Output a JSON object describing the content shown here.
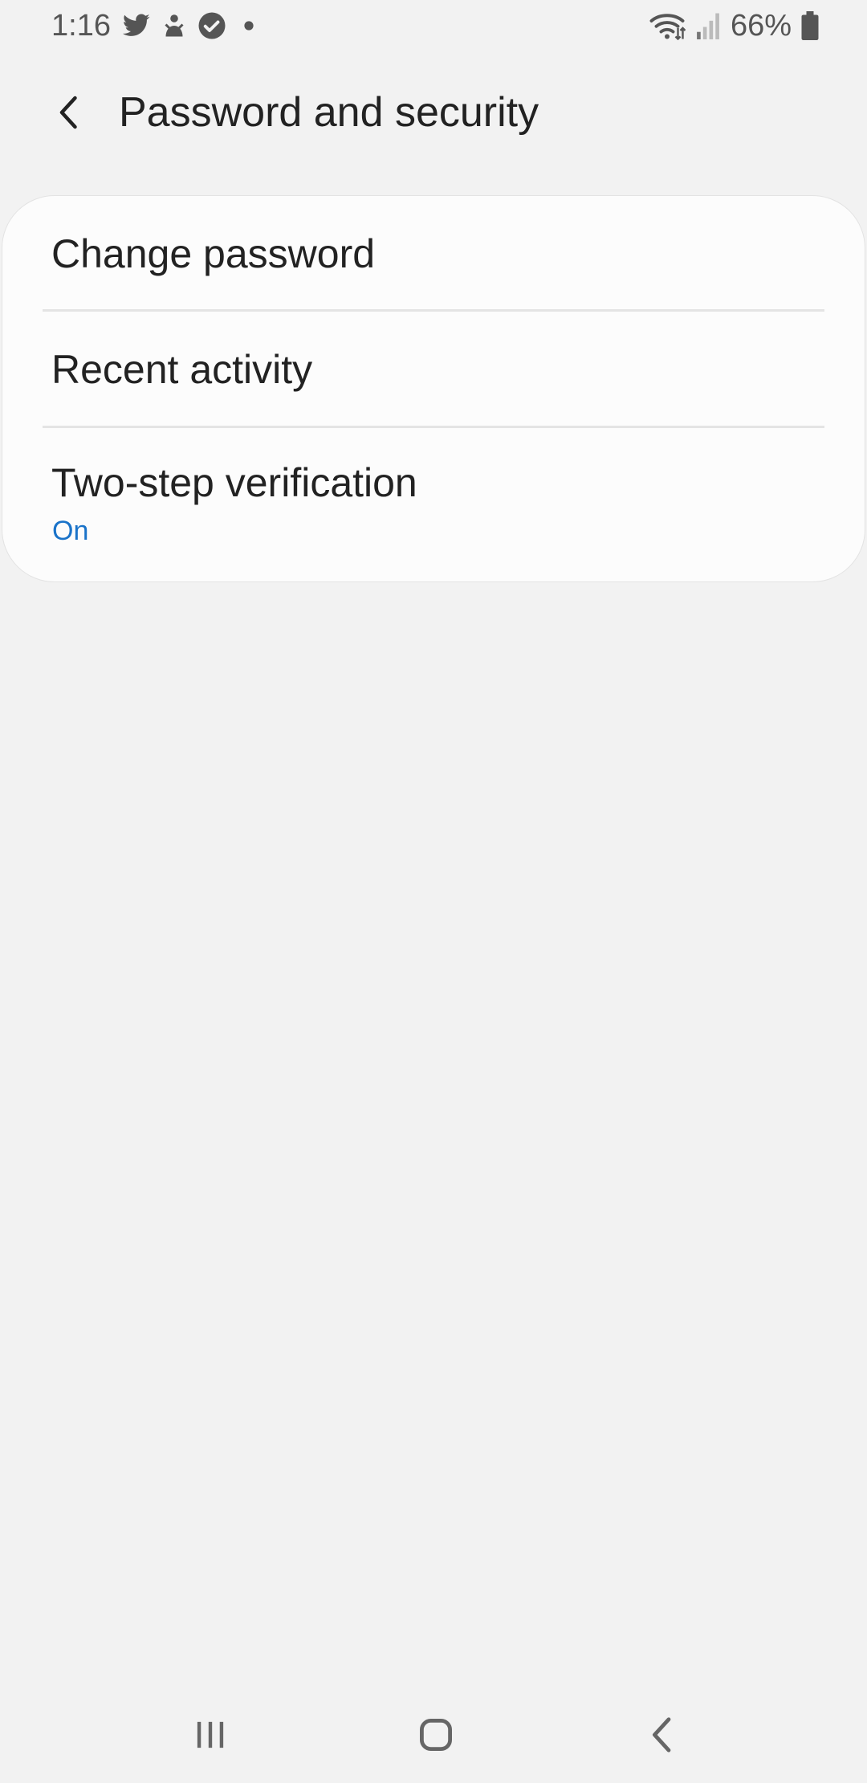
{
  "status_bar": {
    "time": "1:16",
    "battery": "66%",
    "icons_left": [
      "twitter-icon",
      "notification-app-icon",
      "check-circle-icon",
      "dot-icon"
    ],
    "icons_right": [
      "wifi-icon",
      "signal-icon",
      "battery-icon"
    ]
  },
  "header": {
    "title": "Password and security",
    "back_icon": "chevron-left-icon"
  },
  "menu": {
    "items": [
      {
        "label": "Change password"
      },
      {
        "label": "Recent activity"
      },
      {
        "label": "Two-step verification",
        "status": "On"
      }
    ]
  },
  "colors": {
    "background": "#f2f2f2",
    "card": "#fcfcfc",
    "accent": "#1a73c9",
    "text": "#222222",
    "status_text": "#555555"
  },
  "nav_bar": {
    "buttons": [
      "recents-icon",
      "home-icon",
      "back-icon"
    ]
  }
}
